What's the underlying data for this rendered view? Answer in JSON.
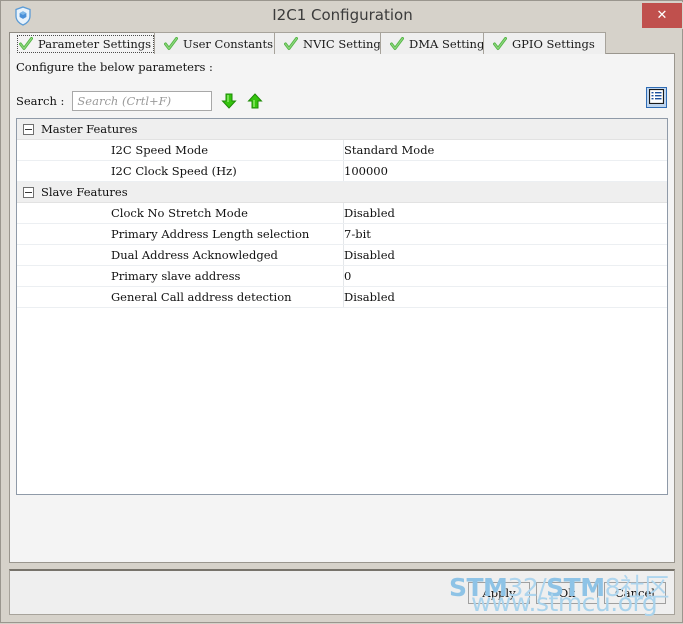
{
  "window": {
    "title": "I2C1 Configuration",
    "icon": "shield-icon",
    "close_label": "✕"
  },
  "tabs": [
    {
      "label": "Parameter Settings",
      "icon": "green-check-icon",
      "active": true
    },
    {
      "label": "User Constants",
      "icon": "green-check-icon",
      "active": false
    },
    {
      "label": "NVIC Settings",
      "icon": "green-check-icon",
      "active": false
    },
    {
      "label": "DMA Settings",
      "icon": "green-check-icon",
      "active": false
    },
    {
      "label": "GPIO Settings",
      "icon": "green-check-icon",
      "active": false
    }
  ],
  "content": {
    "instruction": "Configure the below parameters :",
    "search": {
      "label": "Search :",
      "value": "",
      "placeholder": "Search (Crtl+F)",
      "find_next_icon": "green-down-arrow-icon",
      "find_prev_icon": "green-up-arrow-icon"
    },
    "list_view_icon": "list-view-icon"
  },
  "param_groups": [
    {
      "name": "Master Features",
      "expanded": true,
      "rows": [
        {
          "name": "I2C Speed Mode",
          "value": "Standard Mode"
        },
        {
          "name": "I2C Clock Speed (Hz)",
          "value": "100000"
        }
      ]
    },
    {
      "name": "Slave Features",
      "expanded": true,
      "rows": [
        {
          "name": "Clock No Stretch Mode",
          "value": "Disabled"
        },
        {
          "name": "Primary Address Length selection",
          "value": "7-bit"
        },
        {
          "name": "Dual Address Acknowledged",
          "value": "Disabled"
        },
        {
          "name": "Primary slave address",
          "value": "0"
        },
        {
          "name": "General Call address detection",
          "value": "Disabled"
        }
      ]
    }
  ],
  "buttons": {
    "apply": "Apply",
    "ok": "Ok",
    "cancel": "Cancel"
  },
  "watermark": {
    "line1_a": "STM",
    "line1_b": "32/",
    "line1_c": "STM",
    "line1_d": "8社区",
    "line2": "www.stmcu.org"
  },
  "colors": {
    "close_red": "#c0504d",
    "check_green": "#55b546",
    "accent_blue": "#2f6cb5",
    "watermark_blue": "#8ec3e6",
    "window_chrome": "#d6d2ca"
  }
}
